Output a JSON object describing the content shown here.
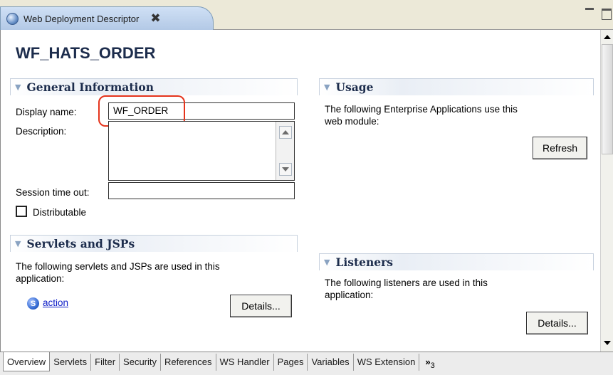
{
  "editor": {
    "tab_title": "Web Deployment Descriptor",
    "close_glyph": "✖",
    "page_title": "WF_HATS_ORDER"
  },
  "general_information": {
    "title": "General Information",
    "display_name_label": "Display name:",
    "display_name_value": "WF_ORDER",
    "description_label": "Description:",
    "description_value": "",
    "session_timeout_label": "Session time out:",
    "session_timeout_value": "",
    "distributable_label": "Distributable",
    "distributable_checked": false
  },
  "usage": {
    "title": "Usage",
    "text_line1": "The following Enterprise Applications use this",
    "text_line2": "web module:",
    "refresh_label": "Refresh"
  },
  "servlets": {
    "title": "Servlets and JSPs",
    "text_line1": "The following servlets and JSPs are used in this",
    "text_line2": "application:",
    "item_icon_glyph": "S",
    "item_label": "action",
    "details_label": "Details..."
  },
  "listeners": {
    "title": "Listeners",
    "text_line1": "The following listeners are used in this",
    "text_line2": "application:",
    "details_label": "Details..."
  },
  "bottom_tabs": [
    "Overview",
    "Servlets",
    "Filter",
    "Security",
    "References",
    "WS Handler",
    "Pages",
    "Variables",
    "WS Extension"
  ],
  "overflow": {
    "chevron": "»",
    "count": "3"
  },
  "colors": {
    "section_title": "#1c2c4c",
    "highlight": "#e5341c",
    "link": "#1020c8"
  },
  "icons": {
    "tab": "globe-icon",
    "close": "close-icon",
    "section_twisty": "chevron-down-icon",
    "servlet": "servlet-icon"
  }
}
